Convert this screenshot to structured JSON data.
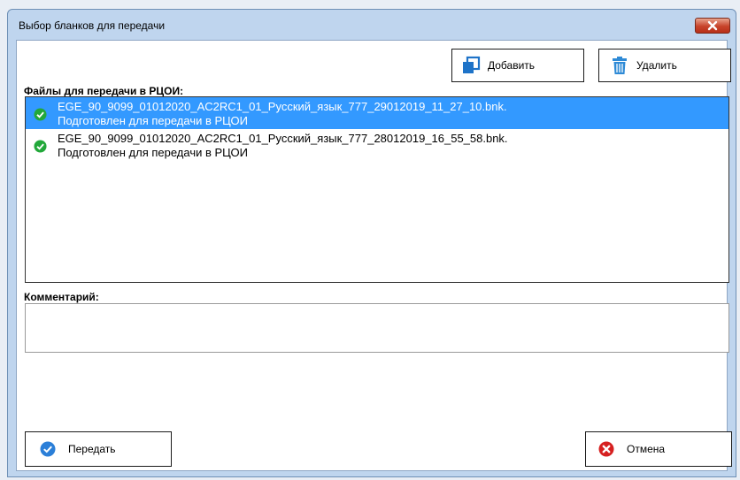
{
  "window": {
    "title": "Выбор бланков для передачи"
  },
  "toolbar": {
    "add_label": "Добавить",
    "delete_label": "Удалить"
  },
  "files": {
    "label": "Файлы для передачи в РЦОИ:",
    "items": [
      {
        "name": "EGE_90_9099_01012020_AC2RC1_01_Русский_язык_777_29012019_11_27_10.bnk.",
        "status": "Подготовлен для передачи в РЦОИ",
        "selected": true
      },
      {
        "name": "EGE_90_9099_01012020_AC2RC1_01_Русский_язык_777_28012019_16_55_58.bnk.",
        "status": "Подготовлен для передачи в РЦОИ",
        "selected": false
      }
    ]
  },
  "comment": {
    "label": "Комментарий:",
    "value": ""
  },
  "actions": {
    "send_label": "Передать",
    "cancel_label": "Отмена"
  },
  "colors": {
    "selection": "#3399ff",
    "check": "#22a83a",
    "send_icon": "#2b7fd8",
    "cancel_icon": "#d62020",
    "close_button": "#c7432a"
  },
  "icons": {
    "add": "window-restore-icon",
    "delete": "trash-icon",
    "file_status": "check-circle-icon",
    "send": "check-circle-icon",
    "cancel": "cancel-x-icon",
    "close": "close-icon"
  }
}
